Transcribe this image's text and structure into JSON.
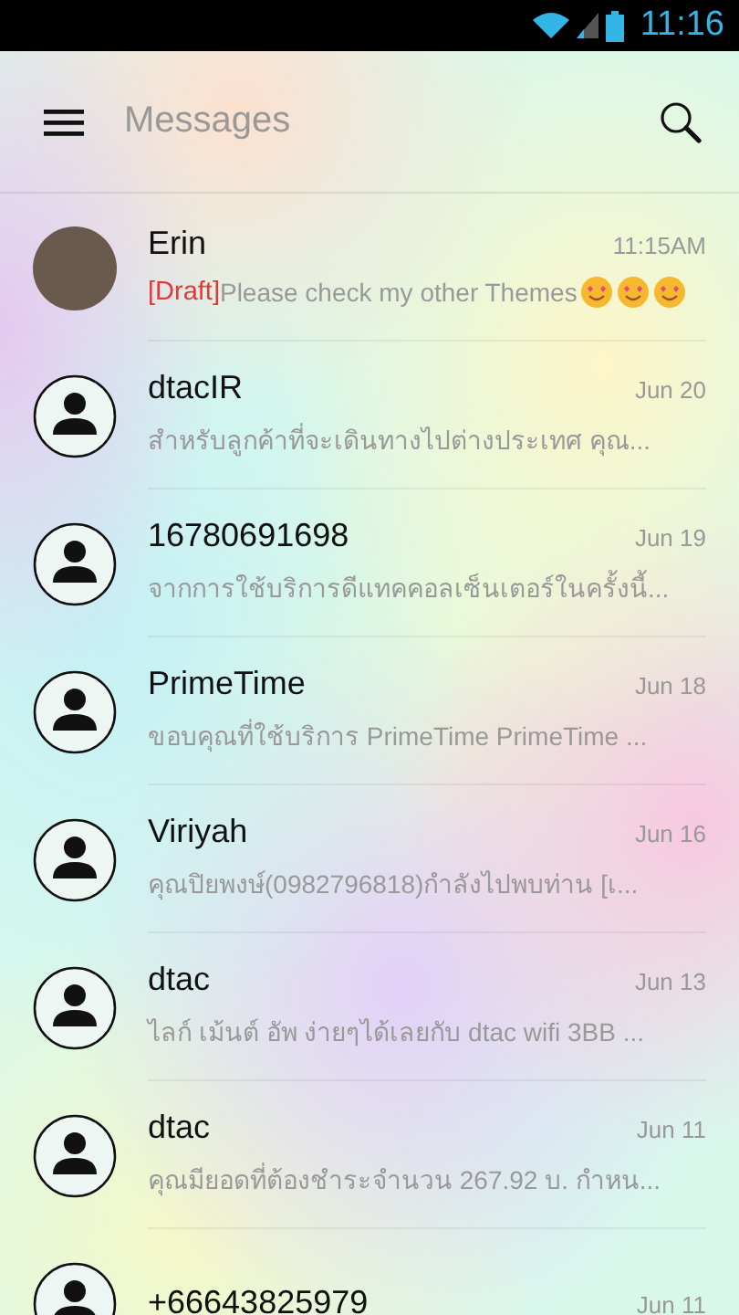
{
  "status_bar": {
    "time": "11:16"
  },
  "toolbar": {
    "title": "Messages"
  },
  "conversations": [
    {
      "kind": "photo",
      "name": "Erin",
      "time": "11:15AM",
      "draft_label": "[Draft]",
      "snippet": "Please check my other Themes"
    },
    {
      "kind": "contact",
      "name": "dtacIR",
      "time": "Jun 20",
      "snippet": "สำหรับลูกค้าที่จะเดินทางไปต่างประเทศ คุณ..."
    },
    {
      "kind": "contact",
      "name": "16780691698",
      "time": "Jun 19",
      "snippet": "จากการใช้บริการดีแทคคอลเซ็นเตอร์ในครั้งนี้..."
    },
    {
      "kind": "contact",
      "name": "PrimeTime",
      "time": "Jun 18",
      "snippet": "ขอบคุณที่ใช้บริการ PrimeTime PrimeTime ..."
    },
    {
      "kind": "contact",
      "name": "Viriyah",
      "time": "Jun 16",
      "snippet": "คุณปิยพงษ์(0982796818)กำลังไปพบท่าน [เ..."
    },
    {
      "kind": "contact",
      "name": "dtac",
      "time": "Jun 13",
      "snippet": "ไลก์ เม้นต์ อัพ ง่ายๆได้เลยกับ dtac wifi 3BB ..."
    },
    {
      "kind": "contact",
      "name": "dtac",
      "time": "Jun 11",
      "snippet": "คุณมียอดที่ต้องชำระจำนวน 267.92 บ. กำหน..."
    },
    {
      "kind": "contact",
      "name": "+66643825979",
      "time": "Jun 11"
    }
  ]
}
